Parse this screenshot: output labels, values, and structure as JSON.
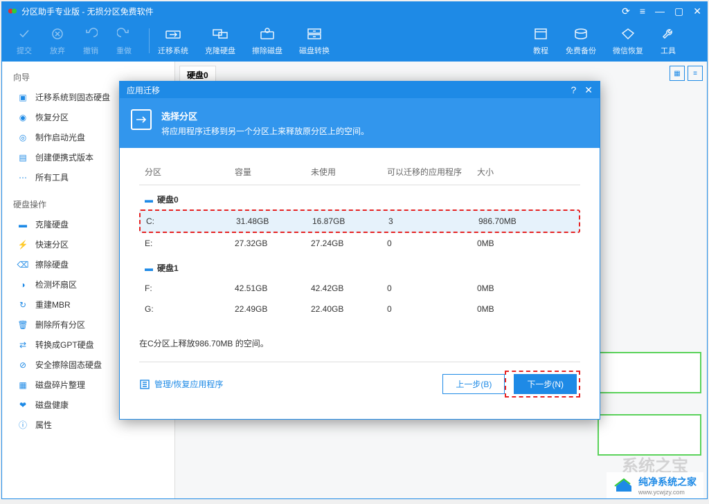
{
  "titlebar": {
    "title": "分区助手专业版 - 无损分区免费软件"
  },
  "toolbar": {
    "submit": "提交",
    "discard": "放弃",
    "undo": "撤销",
    "redo": "重做",
    "migrate_os": "迁移系统",
    "clone_disk": "克隆硬盘",
    "wipe_disk": "擦除磁盘",
    "convert_disk": "磁盘转换",
    "tutorial": "教程",
    "free_backup": "免费备份",
    "wx_restore": "微信恢复",
    "tools": "工具"
  },
  "sidebar": {
    "wizard_title": "向导",
    "wizard": [
      {
        "k": "migrate-ssd",
        "label": "迁移系统到固态硬盘"
      },
      {
        "k": "restore-part",
        "label": "恢复分区"
      },
      {
        "k": "boot-disc",
        "label": "制作启动光盘"
      },
      {
        "k": "portable",
        "label": "创建便携式版本"
      },
      {
        "k": "all-tools",
        "label": "所有工具"
      }
    ],
    "diskops_title": "硬盘操作",
    "diskops": [
      {
        "k": "clone",
        "label": "克隆硬盘"
      },
      {
        "k": "quick-part",
        "label": "快速分区"
      },
      {
        "k": "wipe",
        "label": "擦除硬盘"
      },
      {
        "k": "check-sector",
        "label": "检测坏扇区"
      },
      {
        "k": "rebuild-mbr",
        "label": "重建MBR"
      },
      {
        "k": "delete-all",
        "label": "删除所有分区"
      },
      {
        "k": "to-gpt",
        "label": "转换成GPT硬盘"
      },
      {
        "k": "secure-wipe",
        "label": "安全擦除固态硬盘"
      },
      {
        "k": "defrag",
        "label": "磁盘碎片整理"
      },
      {
        "k": "health",
        "label": "磁盘健康"
      },
      {
        "k": "props",
        "label": "属性"
      }
    ]
  },
  "main": {
    "disk0": "硬盘0"
  },
  "dialog": {
    "title": "应用迁移",
    "header_title": "选择分区",
    "header_sub": "将应用程序迁移到另一个分区上来释放原分区上的空间。",
    "cols": {
      "part": "分区",
      "cap": "容量",
      "unused": "未使用",
      "migratable": "可以迁移的应用程序",
      "size": "大小"
    },
    "disk_labels": {
      "d0": "硬盘0",
      "d1": "硬盘1"
    },
    "rows_d0": [
      {
        "p": "C:",
        "c": "31.48GB",
        "u": "16.87GB",
        "m": "3",
        "s": "986.70MB",
        "sel": true
      },
      {
        "p": "E:",
        "c": "27.32GB",
        "u": "27.24GB",
        "m": "0",
        "s": "0MB",
        "sel": false
      }
    ],
    "rows_d1": [
      {
        "p": "F:",
        "c": "42.51GB",
        "u": "42.42GB",
        "m": "0",
        "s": "0MB"
      },
      {
        "p": "G:",
        "c": "22.49GB",
        "u": "22.40GB",
        "m": "0",
        "s": "0MB"
      }
    ],
    "note": "在C分区上释放986.70MB 的空间。",
    "manage_link": "管理/恢复应用程序",
    "prev": "上一步(B)",
    "next": "下一步(N)"
  },
  "watermark": {
    "text": "纯净系统之家",
    "sub": "www.ycwjzy.com"
  },
  "ghost": "系统之宝"
}
